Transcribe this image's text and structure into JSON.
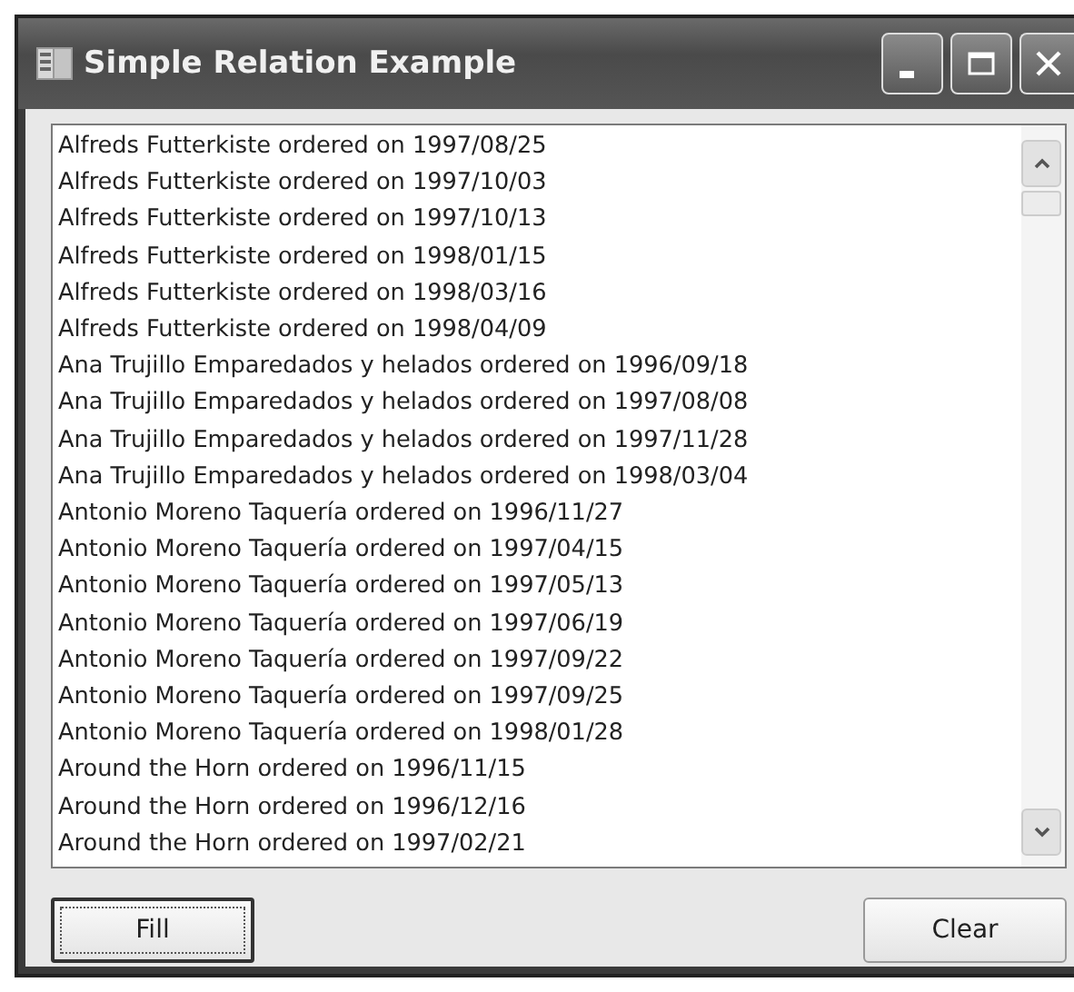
{
  "window": {
    "title": "Simple Relation Example"
  },
  "list": {
    "items": [
      "Alfreds Futterkiste ordered on 1997/08/25",
      "Alfreds Futterkiste ordered on 1997/10/03",
      "Alfreds Futterkiste ordered on 1997/10/13",
      "Alfreds Futterkiste ordered on 1998/01/15",
      "Alfreds Futterkiste ordered on 1998/03/16",
      "Alfreds Futterkiste ordered on 1998/04/09",
      "Ana Trujillo Emparedados y helados ordered on 1996/09/18",
      "Ana Trujillo Emparedados y helados ordered on 1997/08/08",
      "Ana Trujillo Emparedados y helados ordered on 1997/11/28",
      "Ana Trujillo Emparedados y helados ordered on 1998/03/04",
      "Antonio Moreno Taquería ordered on 1996/11/27",
      "Antonio Moreno Taquería ordered on 1997/04/15",
      "Antonio Moreno Taquería ordered on 1997/05/13",
      "Antonio Moreno Taquería ordered on 1997/06/19",
      "Antonio Moreno Taquería ordered on 1997/09/22",
      "Antonio Moreno Taquería ordered on 1997/09/25",
      "Antonio Moreno Taquería ordered on 1998/01/28",
      "Around the Horn ordered on 1996/11/15",
      "Around the Horn ordered on 1996/12/16",
      "Around the Horn ordered on 1997/02/21"
    ]
  },
  "buttons": [
    {
      "label": "Fill",
      "default": true
    },
    {
      "label": "Clear",
      "default": false
    }
  ]
}
